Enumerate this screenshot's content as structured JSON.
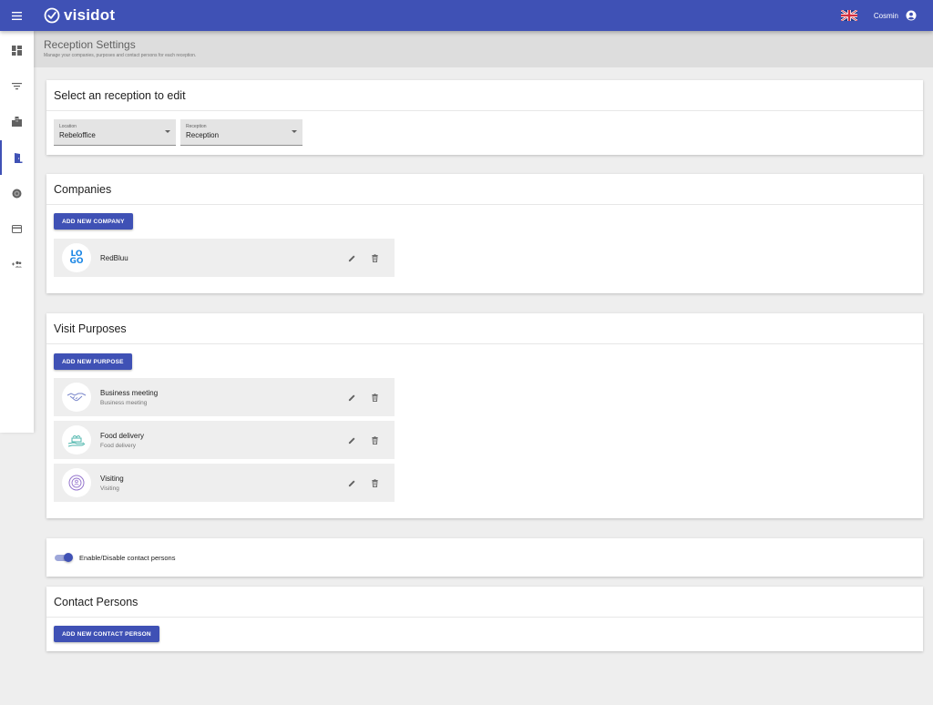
{
  "app": {
    "brand": "visidot",
    "user": "Cosmin",
    "language_flag": "uk-flag-icon"
  },
  "nav": [
    {
      "icon": "dashboard-icon"
    },
    {
      "icon": "filter-icon"
    },
    {
      "icon": "buildings-icon"
    },
    {
      "icon": "door-icon",
      "active": true
    },
    {
      "icon": "target-icon"
    },
    {
      "icon": "card-icon"
    },
    {
      "icon": "add-users-icon"
    }
  ],
  "header": {
    "title": "Reception Settings",
    "subtitle": "Manage your companies, purposes and contact persons for each reception."
  },
  "select_section": {
    "title": "Select an reception to edit",
    "location": {
      "label": "Location",
      "value": "Rebeloffice"
    },
    "reception": {
      "label": "Reception",
      "value": "Reception"
    }
  },
  "companies": {
    "title": "Companies",
    "add_label": "ADD NEW COMPANY",
    "items": [
      {
        "name": "RedBluu",
        "logo_text": [
          "LO",
          "GO"
        ]
      }
    ]
  },
  "purposes": {
    "title": "Visit Purposes",
    "add_label": "ADD NEW PURPOSE",
    "items": [
      {
        "title": "Business meeting",
        "subtitle": "Business meeting",
        "icon": "handshake-icon"
      },
      {
        "title": "Food delivery",
        "subtitle": "Food delivery",
        "icon": "food-delivery-icon"
      },
      {
        "title": "Visiting",
        "subtitle": "Visiting",
        "icon": "visitor-icon"
      }
    ]
  },
  "contact_toggle": {
    "label": "Enable/Disable contact persons",
    "enabled": true
  },
  "contacts": {
    "title": "Contact Persons",
    "add_label": "ADD NEW CONTACT PERSON"
  },
  "colors": {
    "primary": "#3f51b5",
    "toggle_track": "#9fa8da",
    "background": "#eeeeee"
  }
}
